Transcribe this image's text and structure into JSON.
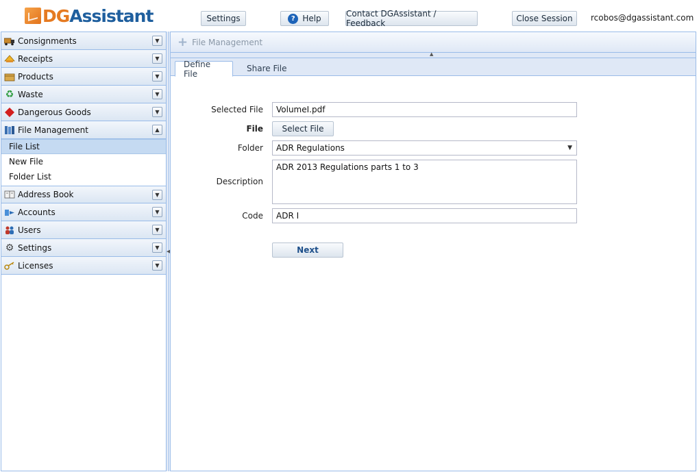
{
  "logo": {
    "part1": "DG",
    "part2": "Assistant"
  },
  "header": {
    "settings_label": "Settings",
    "help_label": "Help",
    "contact_label": "Contact DGAssistant / Feedback",
    "close_label": "Close Session",
    "user_email": "rcobos@dgassistant.com"
  },
  "sidebar": {
    "top_sections": [
      {
        "label": "Consignments",
        "icon": "truck-icon"
      },
      {
        "label": "Receipts",
        "icon": "receipt-icon"
      },
      {
        "label": "Products",
        "icon": "box-icon"
      },
      {
        "label": "Waste",
        "icon": "recycle-icon"
      },
      {
        "label": "Dangerous Goods",
        "icon": "hazard-diamond-icon"
      },
      {
        "label": "File Management",
        "icon": "books-icon"
      }
    ],
    "file_management_items": [
      "File List",
      "New File",
      "Folder List"
    ],
    "bottom_sections": [
      {
        "label": "Address Book",
        "icon": "address-book-icon"
      },
      {
        "label": "Accounts",
        "icon": "accounts-icon"
      },
      {
        "label": "Users",
        "icon": "users-icon"
      },
      {
        "label": "Settings",
        "icon": "gear-icon"
      },
      {
        "label": "Licenses",
        "icon": "key-icon"
      }
    ]
  },
  "main": {
    "panel_title": "File Management",
    "tabs": [
      "Define File",
      "Share File"
    ],
    "form": {
      "selected_file_label": "Selected File",
      "selected_file_value": "VolumeI.pdf",
      "file_label": "File",
      "select_file_button": "Select File",
      "folder_label": "Folder",
      "folder_value": "ADR Regulations",
      "description_label": "Description",
      "description_value": "ADR 2013 Regulations parts 1 to 3",
      "code_label": "Code",
      "code_value": "ADR I",
      "next_button": "Next"
    }
  },
  "colors": {
    "accent_orange": "#e57a21",
    "accent_blue": "#1f5f9e",
    "border_blue": "#99bbe8"
  }
}
